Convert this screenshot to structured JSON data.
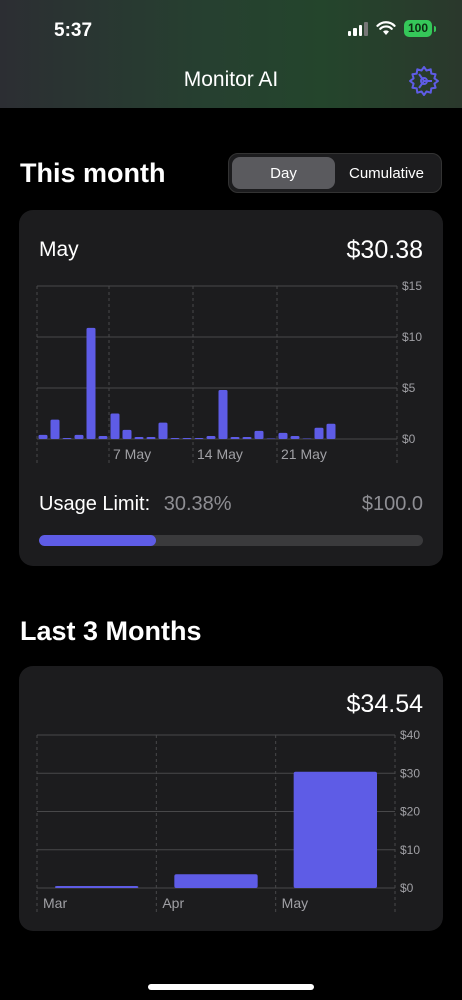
{
  "status": {
    "time": "5:37",
    "battery": "100"
  },
  "nav": {
    "title": "Monitor AI"
  },
  "this_month": {
    "title": "This month",
    "segments": [
      "Day",
      "Cumulative"
    ],
    "selected_segment": "Day",
    "month_label": "May",
    "total": "$30.38",
    "usage_label": "Usage Limit:",
    "usage_percent_text": "30.38%",
    "usage_fraction": 0.3038,
    "usage_limit": "$100.0"
  },
  "last_three": {
    "title": "Last 3 Months",
    "total": "$34.54"
  },
  "colors": {
    "accent": "#5e5ce6",
    "card": "#1c1c1e",
    "battery": "#35c759"
  },
  "chart_data": [
    {
      "type": "bar",
      "x": [
        1,
        2,
        3,
        4,
        5,
        6,
        7,
        8,
        9,
        10,
        11,
        12,
        13,
        14,
        15,
        16,
        17,
        18,
        19,
        20,
        21,
        22,
        23,
        24,
        25,
        26,
        27
      ],
      "values": [
        0.4,
        1.9,
        0.1,
        0.4,
        10.9,
        0.3,
        2.5,
        0.9,
        0.2,
        0.2,
        1.6,
        0.1,
        0.1,
        0.1,
        0.3,
        4.8,
        0.2,
        0.2,
        0.8,
        0.05,
        0.6,
        0.3,
        0.05,
        1.1,
        1.5,
        0,
        0
      ],
      "xticks": [
        {
          "x": 7,
          "label": "7 May"
        },
        {
          "x": 14,
          "label": "14 May"
        },
        {
          "x": 21,
          "label": "21 May"
        }
      ],
      "ylim": [
        0,
        15
      ],
      "yticks": [
        "$0",
        "$5",
        "$10",
        "$15"
      ],
      "ytick_values": [
        0,
        5,
        10,
        15
      ],
      "grid": true
    },
    {
      "type": "bar",
      "categories": [
        "Mar",
        "Apr",
        "May"
      ],
      "values": [
        0.5,
        3.6,
        30.38
      ],
      "ylim": [
        0,
        40
      ],
      "yticks": [
        "$0",
        "$10",
        "$20",
        "$30",
        "$40"
      ],
      "ytick_values": [
        0,
        10,
        20,
        30,
        40
      ],
      "grid": true
    }
  ]
}
